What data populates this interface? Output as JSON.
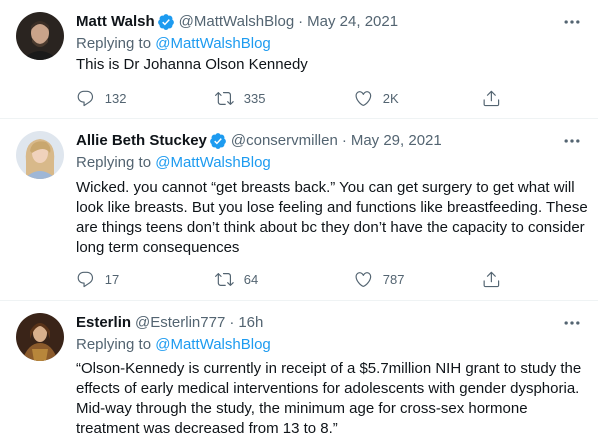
{
  "tweets": [
    {
      "name": "Matt Walsh",
      "verified": true,
      "handle": "@MattWalshBlog",
      "separator": "·",
      "date": "May 24, 2021",
      "reply_prefix": "Replying to",
      "reply_to": "@MattWalshBlog",
      "text": "This is Dr Johanna Olson Kennedy",
      "replies": "132",
      "retweets": "335",
      "likes": "2K"
    },
    {
      "name": "Allie Beth Stuckey",
      "verified": true,
      "handle": "@conservmillen",
      "separator": "·",
      "date": "May 29, 2021",
      "reply_prefix": "Replying to",
      "reply_to": "@MattWalshBlog",
      "text": "Wicked. you cannot “get breasts back.” You can get surgery to get what will look like breasts. But you lose feeling and functions like breastfeeding. These are things teens don’t think about bc they don’t have the capacity to consider long term consequences",
      "replies": "17",
      "retweets": "64",
      "likes": "787"
    },
    {
      "name": "Esterlin",
      "verified": false,
      "handle": "@Esterlin777",
      "separator": "·",
      "date": "16h",
      "reply_prefix": "Replying to",
      "reply_to": "@MattWalshBlog",
      "text": "“Olson-Kennedy is currently in receipt of a $5.7million NIH grant to study the effects of early medical interventions for adolescents with gender dysphoria. Mid-way through the study, the minimum age for cross-sex hormone treatment was decreased from 13 to 8.”"
    }
  ],
  "icons": {
    "reply": "comment-bubble-icon",
    "retweet": "retweet-icon",
    "like": "heart-icon",
    "share": "share-upload-icon",
    "more": "more-dots-icon",
    "verified": "verified-badge-icon"
  },
  "colors": {
    "link": "#1d9bf0",
    "secondary_text": "#536471",
    "primary_text": "#0f1419",
    "divider": "#eff3f4"
  }
}
